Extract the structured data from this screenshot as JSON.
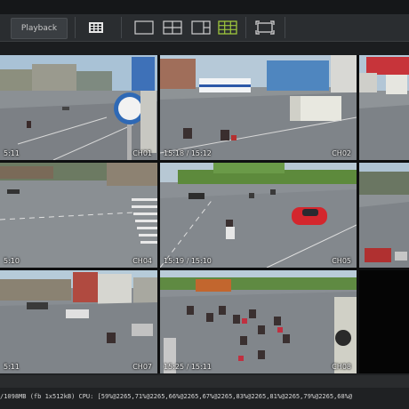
{
  "toolbar": {
    "playback_label": "Playback",
    "icons": [
      "calendar-grid-icon",
      "layout-1-icon",
      "layout-4-icon",
      "layout-6-icon",
      "layout-9-icon",
      "fullscreen-icon"
    ],
    "active_layout": "layout-9-icon",
    "active_color": "#9ec73d"
  },
  "cameras": [
    {
      "time": "5:11",
      "channel": "CH01"
    },
    {
      "time": "15:18 / 15:12",
      "channel": "CH02"
    },
    {
      "time": "",
      "channel": ""
    },
    {
      "time": "5:10",
      "channel": "CH04"
    },
    {
      "time": "15:19 / 15:10",
      "channel": "CH05"
    },
    {
      "time": "",
      "channel": ""
    },
    {
      "time": "5:11",
      "channel": "CH07"
    },
    {
      "time": "15:25 / 15:11",
      "channel": "CH08"
    },
    {
      "time": "",
      "channel": ""
    }
  ],
  "status": {
    "text": "/1098MB (fb 1x512kB) CPU: [59%@2265,71%@2265,66%@2265,67%@2265,83%@2265,81%@2265,79%@2265,68%@"
  }
}
